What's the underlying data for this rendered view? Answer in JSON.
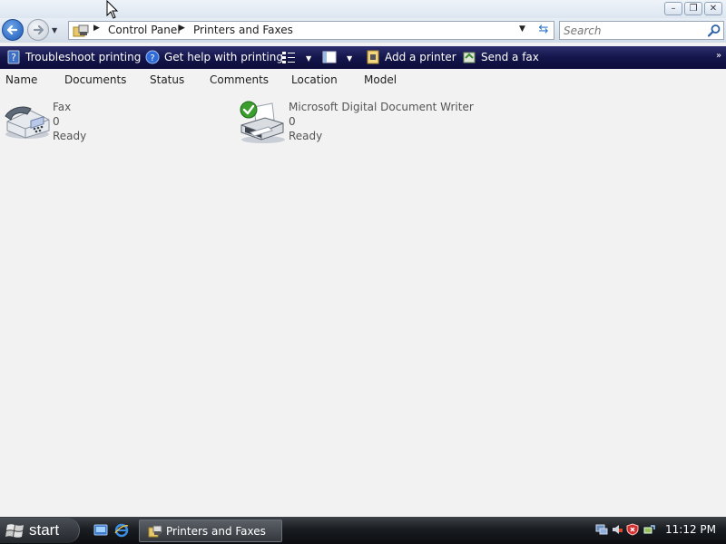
{
  "window": {
    "minimize_label": "–",
    "maximize_label": "❐",
    "close_label": "✕"
  },
  "address": {
    "breadcrumbs": [
      "Control Panel",
      "Printers and Faxes"
    ]
  },
  "search": {
    "placeholder": "Search"
  },
  "commands": [
    {
      "label": "Troubleshoot printing",
      "icon": "help-question-icon"
    },
    {
      "label": "Get help with printing",
      "icon": "help-globe-icon"
    },
    {
      "label": "",
      "icon": "views-icon"
    },
    {
      "label": "",
      "icon": "layout-icon"
    },
    {
      "label": "Add a printer",
      "icon": "add-printer-icon"
    },
    {
      "label": "Send a fax",
      "icon": "send-fax-icon"
    }
  ],
  "columns": [
    "Name",
    "Documents",
    "Status",
    "Comments",
    "Location",
    "Model"
  ],
  "items": [
    {
      "name": "Fax",
      "documents": "0",
      "status": "Ready",
      "icon": "fax-machine-icon",
      "default": false
    },
    {
      "name": "Microsoft Digital Document Writer",
      "documents": "0",
      "status": "Ready",
      "icon": "printer-icon",
      "default": true
    }
  ],
  "taskbar": {
    "start_label": "start",
    "active_window": "Printers and Faxes",
    "clock": "11:12 PM"
  },
  "colors": {
    "command_bar": "#14154a",
    "taskbar": "#1a1d21",
    "back_button": "#1d58b8",
    "default_check": "#3a9d2e"
  }
}
